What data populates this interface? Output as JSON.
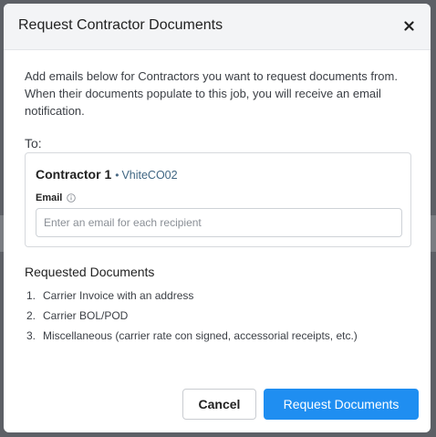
{
  "modal": {
    "title": "Request Contractor Documents",
    "close_icon": "close-icon",
    "intro": "Add emails below for Contractors you want to request documents from. When their documents populate to this job, you will receive an email notification."
  },
  "recipients": {
    "to_label": "To:",
    "contractor": {
      "name": "Contractor 1",
      "bullet": "•",
      "code": "VhiteCO02",
      "email_label": "Email",
      "info_icon": "info-icon",
      "email_value": "",
      "email_placeholder": "Enter an email for each recipient"
    }
  },
  "documents": {
    "title": "Requested Documents",
    "items": [
      {
        "num": "1.",
        "label": "Carrier Invoice with an address"
      },
      {
        "num": "2.",
        "label": "Carrier BOL/POD"
      },
      {
        "num": "3.",
        "label": "Miscellaneous (carrier rate con signed, accessorial receipts, etc.)"
      }
    ]
  },
  "actions": {
    "cancel_label": "Cancel",
    "submit_label": "Request Documents"
  },
  "colors": {
    "primary": "#1f8ef1",
    "backdrop": "#5d6066",
    "header_bg": "#f3f4f6",
    "contractor_code": "#3f6683"
  }
}
